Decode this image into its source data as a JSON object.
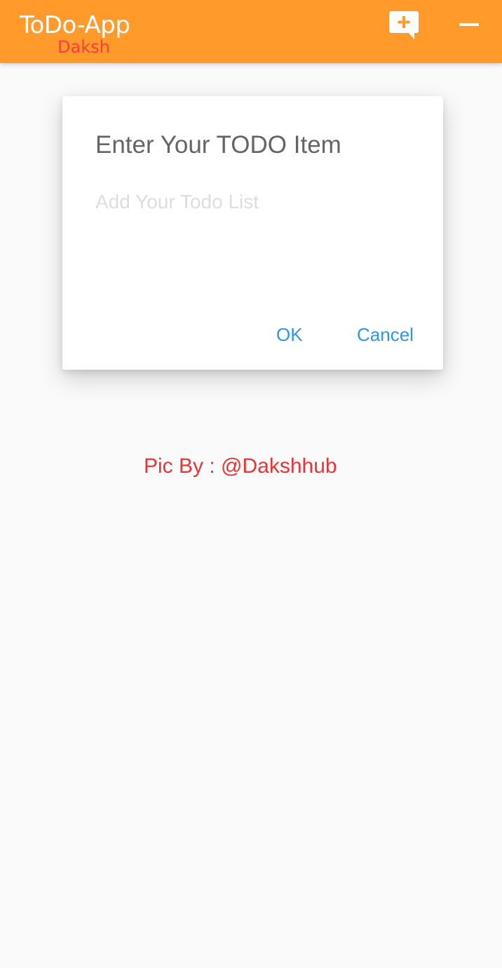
{
  "app_bar": {
    "title": "ToDo-App",
    "subtitle": "Daksh",
    "background_color": "#ff9a2b",
    "title_color": "#ffffff",
    "subtitle_color": "#ff3d3d",
    "actions": [
      {
        "name": "add-comment",
        "icon": "add-comment-icon"
      },
      {
        "name": "remove",
        "icon": "minus-icon"
      }
    ]
  },
  "dialog": {
    "title": "Enter Your TODO Item",
    "input": {
      "value": "",
      "placeholder": "Add Your Todo List"
    },
    "ok_label": "OK",
    "cancel_label": "Cancel",
    "button_color": "#2f95e8"
  },
  "credit": {
    "text": "Pic By : @Dakshhub",
    "color": "#ea3334"
  }
}
